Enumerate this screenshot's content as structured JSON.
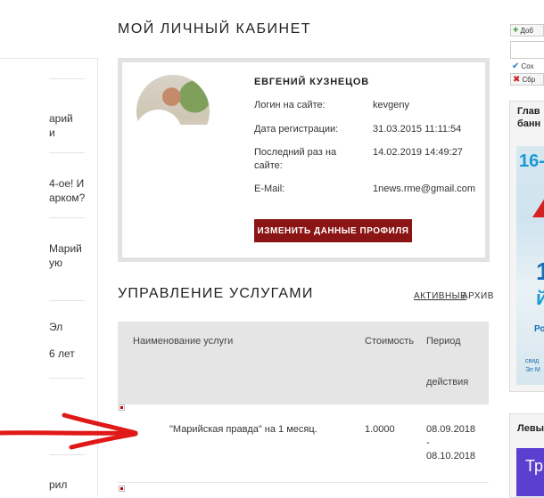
{
  "page_title": "МОЙ ЛИЧНЫЙ КАБИНЕТ",
  "left_sidebar": {
    "items": [
      {
        "text": "арий\nи"
      },
      {
        "text": "4-ое! И\nарком?"
      },
      {
        "text": "Марий\nую"
      },
      {
        "text": "Эл"
      },
      {
        "text": "6 лет"
      },
      {
        "text": "рил"
      }
    ]
  },
  "profile": {
    "name": "ЕВГЕНИЙ КУЗНЕЦОВ",
    "login_label": "Логин на сайте:",
    "login_value": "kevgeny",
    "reg_label": "Дата регистрации:",
    "reg_value": "31.03.2015 11:11:54",
    "last_label_1": "Последний раз на",
    "last_label_2": "сайте:",
    "last_value": "14.02.2019 14:49:27",
    "email_label": "E-Mail:",
    "email_value": "1news.rme@gmail.com",
    "edit_button": "ИЗМЕНИТЬ ДАННЫЕ ПРОФИЛЯ"
  },
  "services": {
    "title": "УПРАВЛЕНИЕ УСЛУГАМИ",
    "tab_active": "АКТИВНЫЕ",
    "tab_archive": "АРХИВ",
    "columns": {
      "name": "Наименование услуги",
      "price": "Стоимость",
      "period_1": "Период",
      "period_2": "действия"
    },
    "rows": [
      {
        "name": "\"Марийская правда\" на 1 месяц.",
        "price": "1.0000",
        "from": "08.09.2018",
        "dash": "-",
        "to": "08.10.2018"
      }
    ]
  },
  "right_panel": {
    "add_label": "Доб",
    "save_label": "Сох",
    "reset_label": "Сбр",
    "box1_title": "Глав\nбанн",
    "banner1_text_1": "16-",
    "banner1_text_2": "1",
    "banner1_text_3": "й",
    "banner1_text_4": "Ро",
    "banner1_text_5": "свид",
    "banner1_text_6": "Эл М",
    "box2_title": "Левы",
    "banner2_text": "Тр"
  },
  "colors": {
    "accent": "#8b1414",
    "arrow": "#e01818"
  }
}
